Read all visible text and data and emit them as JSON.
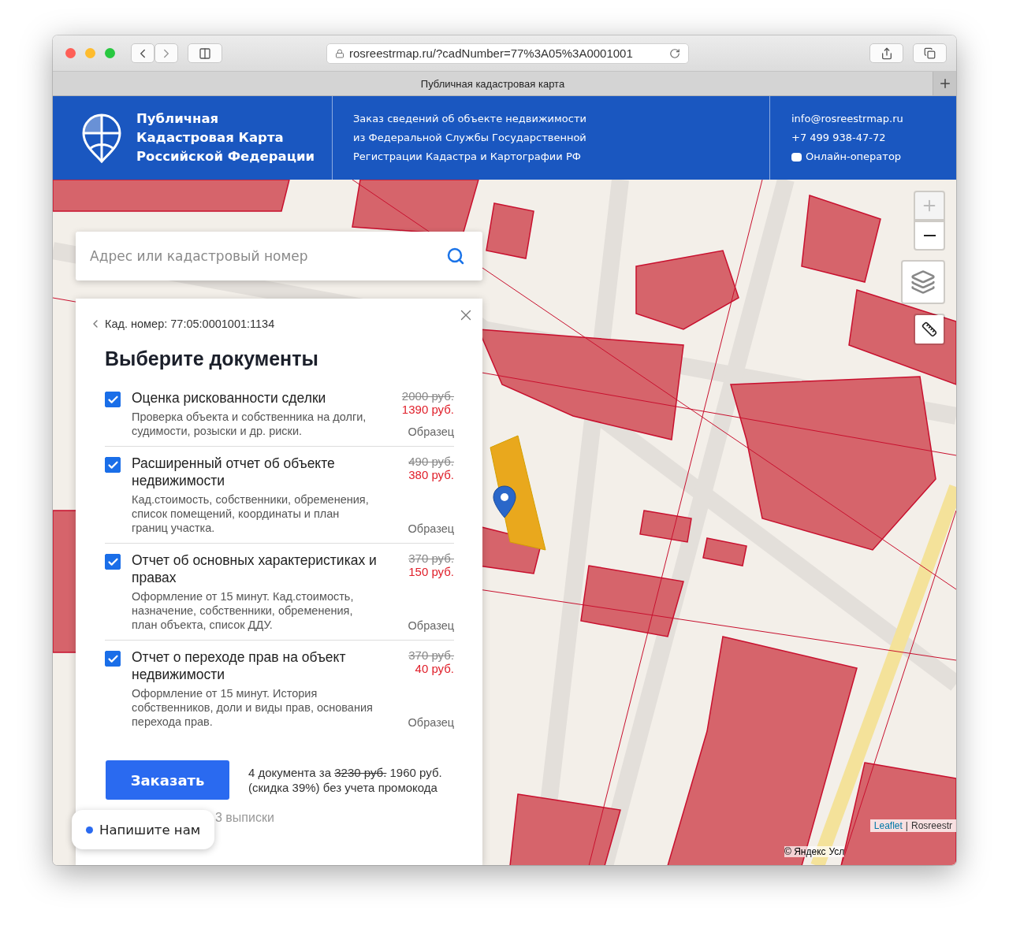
{
  "browser": {
    "url": "rosreestrmap.ru/?cadNumber=77%3A05%3A0001001",
    "tab_title": "Публичная кадастровая карта"
  },
  "header": {
    "title_lines": [
      "Публичная",
      "Кадастровая Карта",
      "Российской Федерации"
    ],
    "about_lines": [
      "Заказ сведений об объекте недвижимости",
      "из Федеральной Службы Государственной",
      "Регистрации Кадастра и Картографии РФ"
    ],
    "email": "info@rosreestrmap.ru",
    "phone": "+7 499 938-47-72",
    "operator": "Онлайн-оператор"
  },
  "search": {
    "placeholder": "Адрес или кадастровый номер"
  },
  "map_controls": {
    "zoom_in": {
      "disabled": true
    },
    "zoom_out": {
      "disabled": false
    }
  },
  "panel": {
    "back_label": "Кад. номер: 77:05:0001001:1134",
    "heading": "Выберите документы",
    "documents": [
      {
        "checked": true,
        "title": "Оценка рискованности сделки",
        "description": "Проверка объекта и собственника на долги, судимости, розыски и др. риски.",
        "old_price": "2000 руб.",
        "price": "1390 руб.",
        "sample": "Образец"
      },
      {
        "checked": true,
        "title": "Расширенный отчет об объекте недвижимости",
        "description": "Кад.стоимость, собственники, обременения, список помещений, координаты и план границ участка.",
        "old_price": "490 руб.",
        "price": "380 руб.",
        "sample": "Образец"
      },
      {
        "checked": true,
        "title": "Отчет об основных характеристиках и правах",
        "description": "Оформление от 15 минут. Кад.стоимость, назначение, собственники, обременения, план объекта, список ДДУ.",
        "old_price": "370 руб.",
        "price": "150 руб.",
        "sample": "Образец"
      },
      {
        "checked": true,
        "title": "Отчет о переходе прав на объект недвижимости",
        "description": "Оформление от 15 минут. История собственников, доли и виды прав, основания перехода прав.",
        "old_price": "370 руб.",
        "price": "40 руб.",
        "sample": "Образец"
      }
    ],
    "order_button": "Заказать",
    "summary": {
      "prefix": "4 документа за",
      "old_total": "3230 руб.",
      "total": "1960 руб.",
      "note": "(скидка 39%) без учета промокода"
    },
    "samples_link": "3 выписки"
  },
  "attribution": {
    "leaflet": "Leaflet",
    "separator": "|",
    "source": "Rosreestr",
    "yandex": "© Яндекс",
    "terms": "Усл"
  },
  "chat": {
    "label": "Напишите нам"
  }
}
